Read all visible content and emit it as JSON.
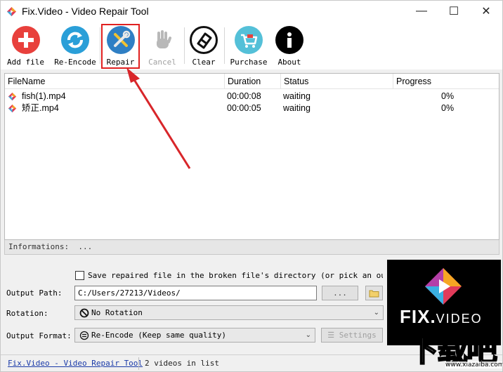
{
  "window": {
    "title": "Fix.Video - Video Repair Tool",
    "controls": {
      "minimize": "—",
      "maximize": "☐",
      "close": "✕"
    }
  },
  "toolbar": {
    "add_file": "Add file",
    "re_encode": "Re-Encode",
    "repair": "Repair",
    "cancel": "Cancel",
    "clear": "Clear",
    "purchase": "Purchase",
    "about": "About"
  },
  "file_list": {
    "columns": [
      "FileName",
      "Duration",
      "Status",
      "Progress"
    ],
    "rows": [
      {
        "name": "fish(1).mp4",
        "duration": "00:00:08",
        "status": "waiting",
        "progress": "0%"
      },
      {
        "name": "矫正.mp4",
        "duration": "00:00:05",
        "status": "waiting",
        "progress": "0%"
      }
    ]
  },
  "info": {
    "label": "Informations:",
    "value": "..."
  },
  "options": {
    "save_in_broken_dir": {
      "label": "Save repaired file in the broken file's directory (or pick an output p",
      "checked": false
    },
    "output_path": {
      "label": "Output Path:",
      "value": "C:/Users/27213/Videos/",
      "browse_label": "..."
    },
    "rotation": {
      "label": "Rotation:",
      "value": "No Rotation"
    },
    "output_format": {
      "label": "Output Format:",
      "value": "Re-Encode (Keep same quality)",
      "settings_label": "Settings"
    }
  },
  "logo": {
    "brand": "FIX.",
    "suffix": "VIDEO"
  },
  "status_bar": {
    "link": "Fix.Video - Video Repair Tool",
    "count": "2 videos in list"
  },
  "watermark": {
    "text": "下载吧",
    "url": "www.xiazaiba.com"
  },
  "colors": {
    "add": "#e8403c",
    "reencode": "#2a9fd8",
    "repair": "#2f7fc4",
    "highlight": "#e02020",
    "link": "#1a3aa8"
  }
}
